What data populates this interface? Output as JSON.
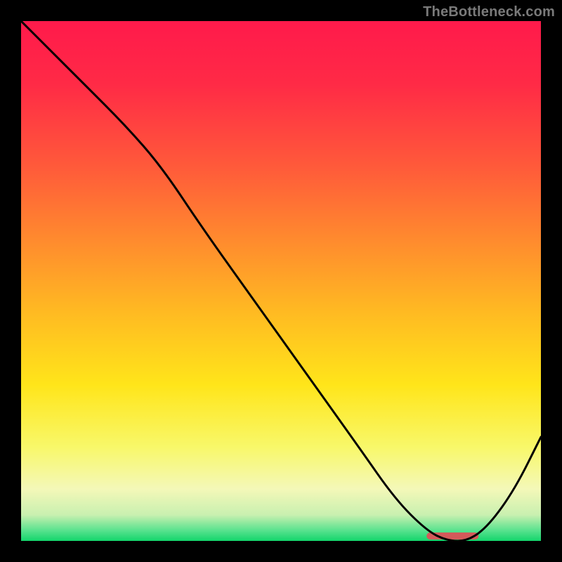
{
  "attribution": "TheBottleneck.com",
  "chart_data": {
    "type": "line",
    "title": "",
    "xlabel": "",
    "ylabel": "",
    "xlim": [
      0,
      100
    ],
    "ylim": [
      0,
      100
    ],
    "series": [
      {
        "name": "curve",
        "x": [
          0,
          5,
          12,
          20,
          27,
          35,
          45,
          55,
          65,
          72,
          78,
          82,
          86,
          90,
          95,
          100
        ],
        "y": [
          100,
          95,
          88,
          80,
          72,
          60,
          46,
          32,
          18,
          8,
          2,
          0,
          0,
          3,
          10,
          20
        ]
      }
    ],
    "marker": {
      "name": "optimal-range",
      "x_start": 78,
      "x_end": 88,
      "color": "#d35a5a"
    },
    "gradient_stops": [
      {
        "offset": 0.0,
        "color": "#ff1a4b"
      },
      {
        "offset": 0.12,
        "color": "#ff2a46"
      },
      {
        "offset": 0.28,
        "color": "#ff5a3a"
      },
      {
        "offset": 0.42,
        "color": "#ff8a2e"
      },
      {
        "offset": 0.56,
        "color": "#ffba22"
      },
      {
        "offset": 0.7,
        "color": "#ffe51a"
      },
      {
        "offset": 0.82,
        "color": "#f8f86a"
      },
      {
        "offset": 0.9,
        "color": "#f4f8b8"
      },
      {
        "offset": 0.95,
        "color": "#c9f0b0"
      },
      {
        "offset": 0.98,
        "color": "#58e28e"
      },
      {
        "offset": 1.0,
        "color": "#13d56b"
      }
    ]
  }
}
